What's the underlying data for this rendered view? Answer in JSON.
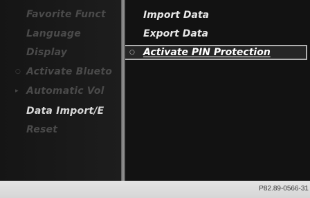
{
  "left_menu": {
    "items": [
      {
        "label": "Favorite Funct",
        "bullet": ""
      },
      {
        "label": "Language",
        "bullet": ""
      },
      {
        "label": "Display",
        "bullet": ""
      },
      {
        "label": "Activate Blueto",
        "bullet": "○"
      },
      {
        "label": "Automatic Vol",
        "bullet": "▸"
      },
      {
        "label": "Data Import/E",
        "bullet": ""
      },
      {
        "label": "Reset",
        "bullet": ""
      }
    ],
    "current_index": 5
  },
  "right_menu": {
    "items": [
      {
        "label": "Import Data"
      },
      {
        "label": "Export Data"
      },
      {
        "label": "Activate PIN Protection",
        "radio_icon": "○",
        "selected": true
      }
    ]
  },
  "footer": {
    "reference": "P82.89-0566-31"
  },
  "colors": {
    "screen_bg": "#141414",
    "inactive_text": "#4a4a4a",
    "active_text": "#d8d8d8",
    "selection_border": "#b0b0b0",
    "footer_bg": "#dcdcdc"
  }
}
